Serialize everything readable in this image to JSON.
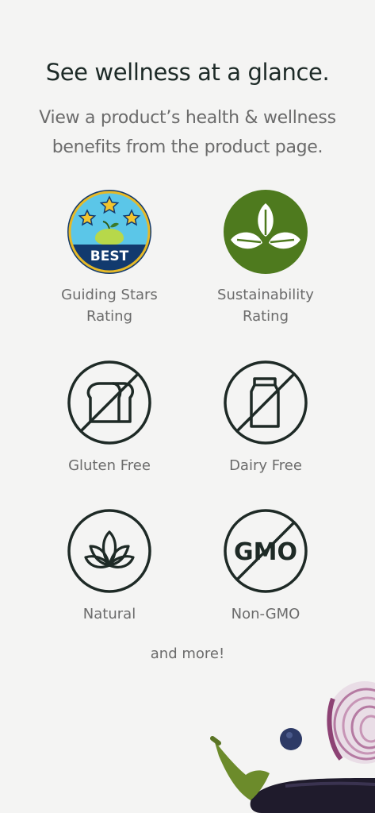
{
  "heading": "See wellness at a glance.",
  "subheading": "View a product’s health & wellness benefits from the product page.",
  "badges": [
    {
      "label": "Guiding Stars\nRating",
      "icon": "guiding-stars-best-icon",
      "badge_text": "BEST"
    },
    {
      "label": "Sustainability\nRating",
      "icon": "sustainability-leaves-icon"
    },
    {
      "label": "Gluten Free",
      "icon": "gluten-free-bread-icon"
    },
    {
      "label": "Dairy Free",
      "icon": "dairy-free-milk-icon"
    },
    {
      "label": "Natural",
      "icon": "natural-plant-icon"
    },
    {
      "label": "Non-GMO",
      "icon": "non-gmo-icon",
      "badge_text": "GMO"
    }
  ],
  "footer_text": "and more!",
  "colors": {
    "heading": "#1d2a27",
    "body_text": "#6b6b6b",
    "icon_stroke": "#1e2a26",
    "sustainability_green": "#4e7a1e",
    "stars_sky": "#5bc6e8",
    "stars_navy": "#123a6e"
  }
}
